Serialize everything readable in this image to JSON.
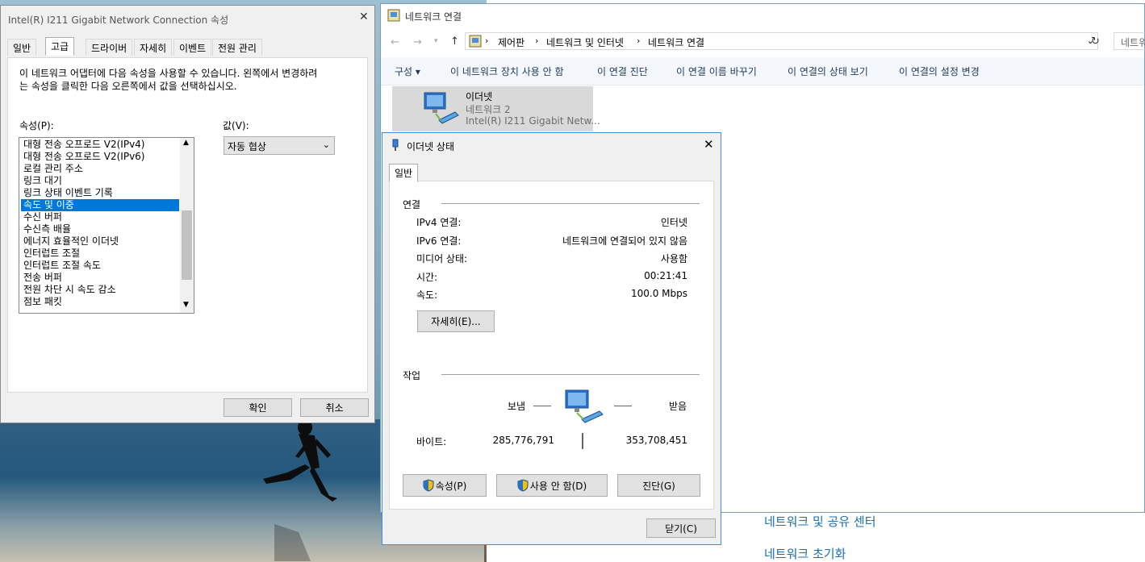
{
  "netconn": {
    "title": "네트워크 연결",
    "breadcrumb": [
      "제어판",
      "네트워크 및 인터넷",
      "네트워크 연결"
    ],
    "search_placeholder": "네트워",
    "commands": [
      "구성 ▾",
      "이 네트워크 장치 사용 안 함",
      "이 연결 진단",
      "이 연결 이름 바꾸기",
      "이 연결의 상태 보기",
      "이 연결의 설정 변경"
    ],
    "adapter": {
      "name": "이더넷",
      "network": "네트워크 2",
      "device": "Intel(R) I211 Gigabit Netw..."
    },
    "bottom_links": [
      "네트워크 및 공유 센터",
      "네트워크 초기화"
    ]
  },
  "props": {
    "title": "Intel(R) I211 Gigabit Network Connection 속성",
    "tabs": [
      "일반",
      "고급",
      "드라이버",
      "자세히",
      "이벤트",
      "전원 관리"
    ],
    "description": "이 네트워크 어댑터에 다음 속성을 사용할 수 있습니다. 왼쪽에서 변경하려는 속성을 클릭한 다음 오른쪽에서 값을 선택하십시오.",
    "property_label": "속성(P):",
    "value_label": "값(V):",
    "properties": [
      "대형 전송 오프로드 V2(IPv4)",
      "대형 전송 오프로드 V2(IPv6)",
      "로컬 관리 주소",
      "링크 대기",
      "링크 상태 이벤트 기록",
      "속도 및 이중",
      "수신 버퍼",
      "수신측 배율",
      "에너지 효율적인 이더넷",
      "인터럽트 조절",
      "인터럽트 조절 속도",
      "전송 버퍼",
      "전원 차단 시 속도 감소",
      "점보 패킷"
    ],
    "selected_property": "속도 및 이중",
    "value_selected": "자동 협상",
    "ok": "확인",
    "cancel": "취소"
  },
  "status": {
    "title": "이더넷 상태",
    "tab": "일반",
    "connection_group": "연결",
    "rows": [
      {
        "label": "IPv4 연결:",
        "value": "인터넷"
      },
      {
        "label": "IPv6 연결:",
        "value": "네트워크에 연결되어 있지 않음"
      },
      {
        "label": "미디어 상태:",
        "value": "사용함"
      },
      {
        "label": "시간:",
        "value": "00:21:41"
      },
      {
        "label": "속도:",
        "value": "100.0 Mbps"
      }
    ],
    "details_button": "자세히(E)...",
    "activity_group": "작업",
    "sent_label": "보냄",
    "received_label": "받음",
    "bytes_label": "바이트:",
    "bytes_sent": "285,776,791",
    "bytes_received": "353,708,451",
    "properties_button": "속성(P)",
    "disable_button": "사용 안 함(D)",
    "diagnose_button": "진단(G)",
    "close_button": "닫기(C)"
  },
  "colors": {
    "selection": "#0078d7",
    "link": "#1a6fb5",
    "status_border": "#3a8ee6"
  }
}
